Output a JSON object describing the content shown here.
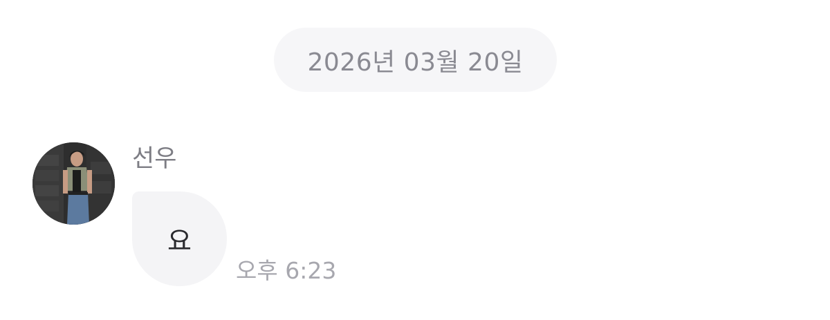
{
  "chat": {
    "date_divider": "2026년 03월 20일",
    "message": {
      "sender_name": "선우",
      "text": "요",
      "time": "오후 6:23",
      "avatar": "profile-photo"
    }
  },
  "colors": {
    "background": "#ffffff",
    "date_pill_bg": "#f6f6f8",
    "bubble_bg": "#f4f4f6",
    "muted_text": "#8a8a92",
    "timestamp_text": "#a7a7ae",
    "message_text": "#2a2a2e"
  }
}
